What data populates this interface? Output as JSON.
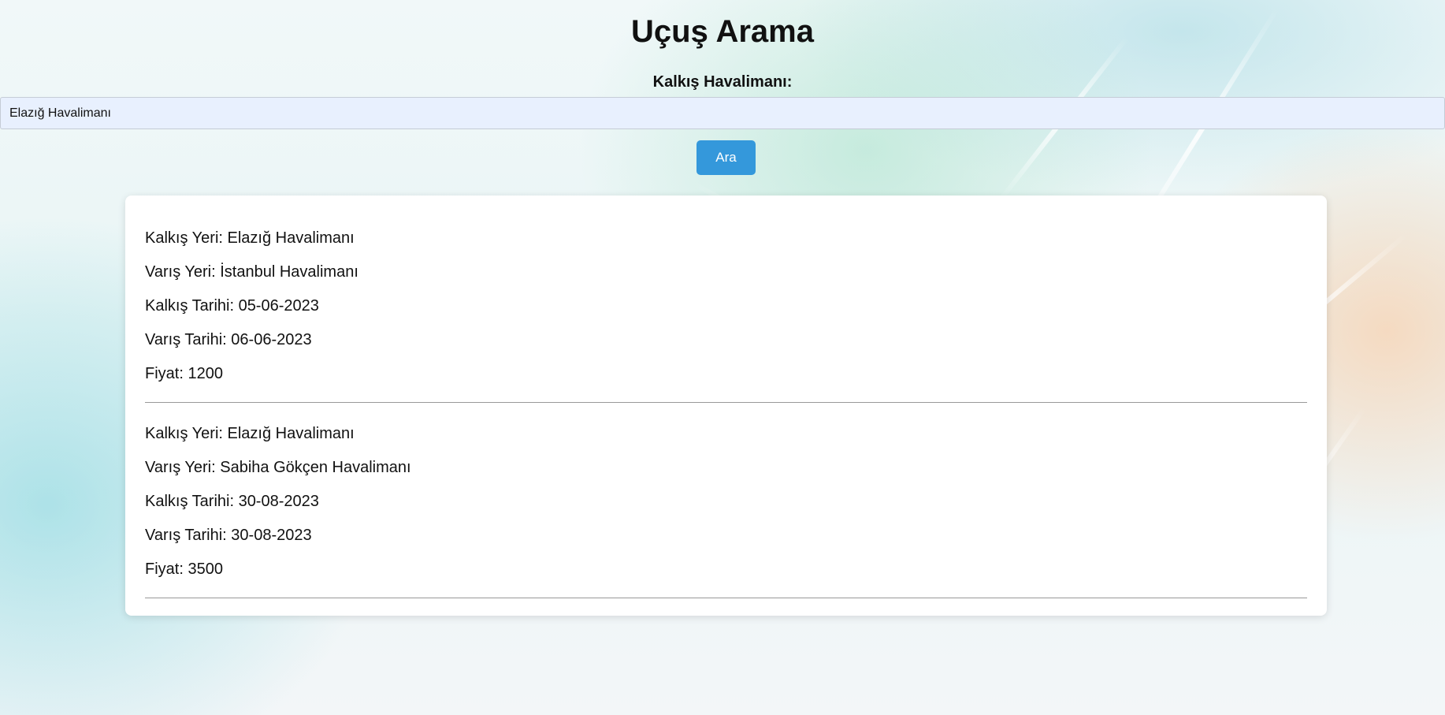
{
  "page": {
    "title": "Uçuş Arama"
  },
  "search": {
    "label": "Kalkış Havalimanı:",
    "value": "Elazığ Havalimanı",
    "button_label": "Ara"
  },
  "results": [
    {
      "departure": "Kalkış Yeri: Elazığ Havalimanı",
      "arrival": "Varış Yeri: İstanbul Havalimanı",
      "departure_date": "Kalkış Tarihi: 05-06-2023",
      "arrival_date": "Varış Tarihi: 06-06-2023",
      "price": "Fiyat: 1200"
    },
    {
      "departure": "Kalkış Yeri: Elazığ Havalimanı",
      "arrival": "Varış Yeri: Sabiha Gökçen Havalimanı",
      "departure_date": "Kalkış Tarihi: 30-08-2023",
      "arrival_date": "Varış Tarihi: 30-08-2023",
      "price": "Fiyat: 3500"
    }
  ],
  "colors": {
    "button_bg": "#3498db",
    "input_bg": "#e8f0fe",
    "card_bg": "#ffffff"
  }
}
